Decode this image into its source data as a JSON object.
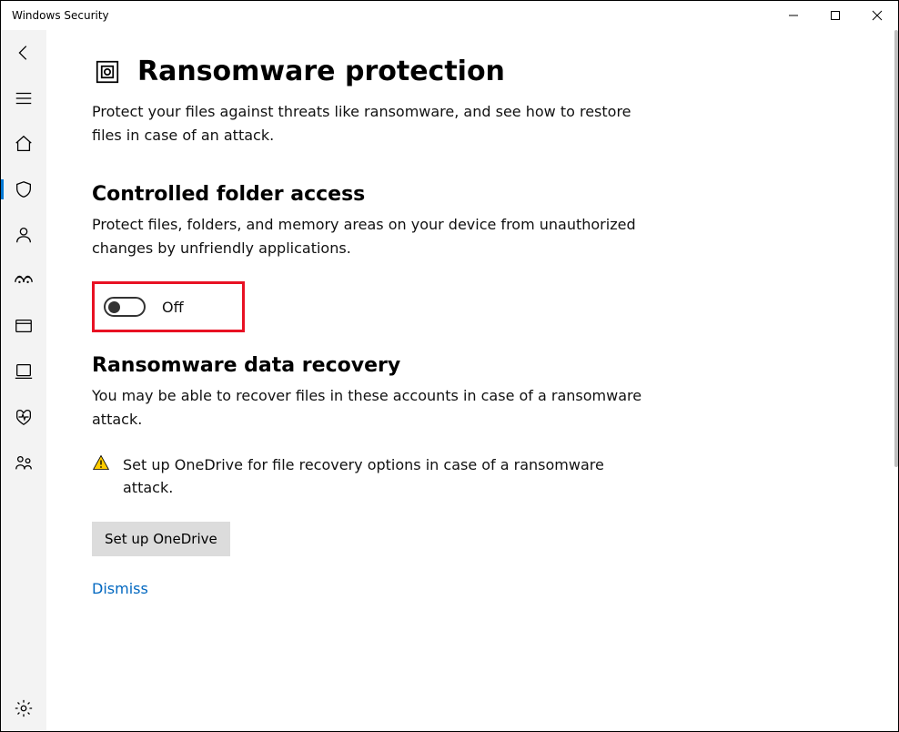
{
  "window": {
    "title": "Windows Security"
  },
  "page": {
    "title": "Ransomware protection",
    "subtitle": "Protect your files against threats like ransomware, and see how to restore files in case of an attack."
  },
  "controlled_folder": {
    "heading": "Controlled folder access",
    "description": "Protect files, folders, and memory areas on your device from unauthorized changes by unfriendly applications.",
    "toggle_state": "Off"
  },
  "recovery": {
    "heading": "Ransomware data recovery",
    "description": "You may be able to recover files in these accounts in case of a ransomware attack.",
    "alert": "Set up OneDrive for file recovery options in case of a ransomware attack.",
    "button": "Set up OneDrive",
    "dismiss": "Dismiss"
  },
  "rail": {
    "items": [
      "back",
      "menu",
      "home",
      "shield",
      "account",
      "network",
      "app",
      "device",
      "heart",
      "family",
      "settings"
    ]
  }
}
